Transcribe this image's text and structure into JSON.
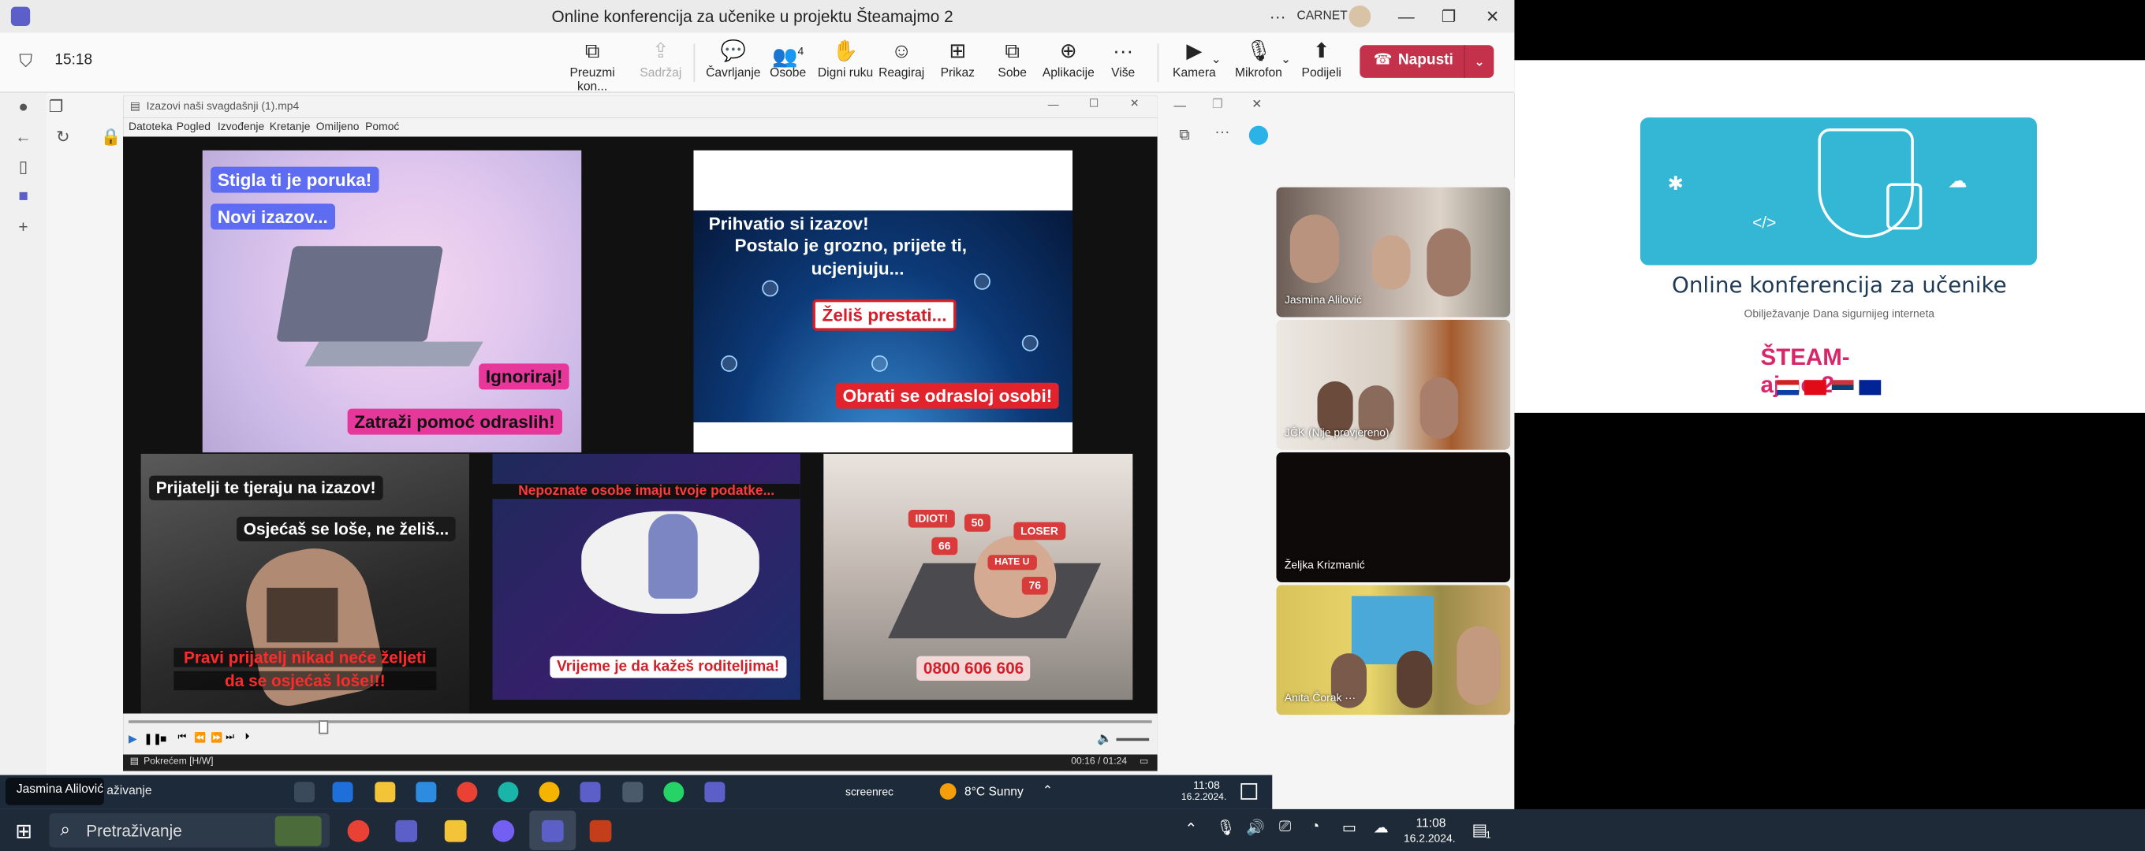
{
  "window": {
    "title": "Online konferencija za učenike u projektu Šteamajmo 2",
    "account": "CARNET"
  },
  "meeting": {
    "timer": "15:18",
    "toolbar": [
      {
        "label": "Preuzmi kon...",
        "icon": "⧉"
      },
      {
        "label": "Sadržaj",
        "icon": "⇪"
      },
      {
        "label": "Čavrljanje",
        "icon": "💬"
      },
      {
        "label": "Osobe",
        "icon": "👥",
        "badge": "4"
      },
      {
        "label": "Digni ruku",
        "icon": "✋"
      },
      {
        "label": "Reagiraj",
        "icon": "☺"
      },
      {
        "label": "Prikaz",
        "icon": "⊞"
      },
      {
        "label": "Sobe",
        "icon": "⧉"
      },
      {
        "label": "Aplikacije",
        "icon": "⊕"
      },
      {
        "label": "Više",
        "icon": "···"
      },
      {
        "label": "Kamera",
        "icon": "▶"
      },
      {
        "label": "Mikrofon",
        "icon": "🎙"
      },
      {
        "label": "Podijeli",
        "icon": "⬆"
      }
    ],
    "leave_label": "Napusti"
  },
  "player": {
    "title": "Izazovi naši svagdašnji (1).mp4",
    "menu": [
      "Datoteka",
      "Pogled",
      "Izvođenje",
      "Kretanje",
      "Omiljeno",
      "Pomoć"
    ],
    "status": "Pokrećem [H/W]",
    "time": "00:16 / 01:24",
    "progress": 0.19
  },
  "video": {
    "p1": [
      "Stigla ti je poruka!",
      "Novi izazov...",
      "Ignoriraj!",
      "Zatraži pomoć odraslih!"
    ],
    "p2": [
      "Prihvatio si izazov!",
      "Postalo je grozno, prijete ti,",
      "ucjenjuju...",
      "Želiš prestati...",
      "Obrati se odrasloj osobi!"
    ],
    "p3": [
      "Prijatelji te tjeraju na izazov!",
      "Osjećaš se loše, ne želiš...",
      "Pravi prijatelj nikad neće željeti",
      "da se osjećaš loše!!!"
    ],
    "p4": [
      "Nepoznate osobe imaju tvoje podatke...",
      "Vrijeme je da kažeš roditeljima!"
    ],
    "p5": [
      "IDIOT!",
      "50",
      "LOSER",
      "66",
      "HATE U",
      "76",
      "0800 606 606"
    ]
  },
  "participants": [
    {
      "name": "Jasmina Alilović"
    },
    {
      "name": "JČK (Nije provjereno)"
    },
    {
      "name": "Željka Krizmanić"
    },
    {
      "name": "Anita Čorak"
    }
  ],
  "shared": {
    "title": "Online konferencija za učenike",
    "subtitle": "Obilježavanje Dana sigurnijeg interneta",
    "logo_text": "ŠTEAM-ajmo 2"
  },
  "inner_taskbar": {
    "presenter_label": "Jasmina Alilović",
    "search_fragment": "aživanje",
    "weather": "8°C  Sunny",
    "clock": "11:08",
    "date": "16.2.2024.",
    "screenrec": "screenrec"
  },
  "taskbar": {
    "search_placeholder": "Pretraživanje",
    "clock": "11:08",
    "date": "16.2.2024.",
    "notif_count": "1"
  }
}
